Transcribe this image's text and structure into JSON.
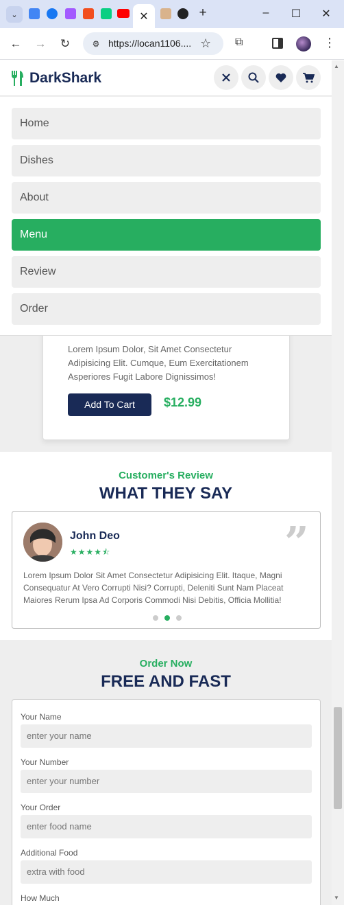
{
  "browser": {
    "url": "https://locan1106....",
    "tabs": [
      "google-translate",
      "facebook",
      "figma",
      "figma",
      "figma",
      "youtube",
      "active-tab",
      "image",
      "github"
    ]
  },
  "header": {
    "logo": "DarkShark"
  },
  "menu": {
    "items": [
      {
        "label": "Home"
      },
      {
        "label": "Dishes"
      },
      {
        "label": "About"
      },
      {
        "label": "Menu"
      },
      {
        "label": "Review"
      },
      {
        "label": "Order"
      }
    ],
    "active": "Menu"
  },
  "dish": {
    "description": "Lorem Ipsum Dolor, Sit Amet Consectetur Adipisicing Elit. Cumque, Eum Exercitationem Asperiores Fugit Labore Dignissimos!",
    "cart_label": "Add To Cart",
    "price": "$12.99"
  },
  "review": {
    "subtitle": "Customer's Review",
    "title": "WHAT THEY SAY",
    "name": "John Deo",
    "rating": 4.5,
    "text": "Lorem Ipsum Dolor Sit Amet Consectetur Adipisicing Elit. Itaque, Magni Consequatur At Vero Corrupti Nisi? Corrupti, Deleniti Sunt Nam Placeat Maiores Rerum Ipsa Ad Corporis Commodi Nisi Debitis, Officia Mollitia!",
    "slides": 3,
    "active_slide": 2
  },
  "order": {
    "subtitle": "Order Now",
    "title": "FREE AND FAST",
    "fields": [
      {
        "label": "Your Name",
        "placeholder": "enter your name"
      },
      {
        "label": "Your Number",
        "placeholder": "enter your number"
      },
      {
        "label": "Your Order",
        "placeholder": "enter food name"
      },
      {
        "label": "Additional Food",
        "placeholder": "extra with food"
      },
      {
        "label": "How Much",
        "placeholder": ""
      }
    ]
  },
  "colors": {
    "brand": "#192a56",
    "accent": "#27ae60",
    "light": "#eeeeee"
  }
}
